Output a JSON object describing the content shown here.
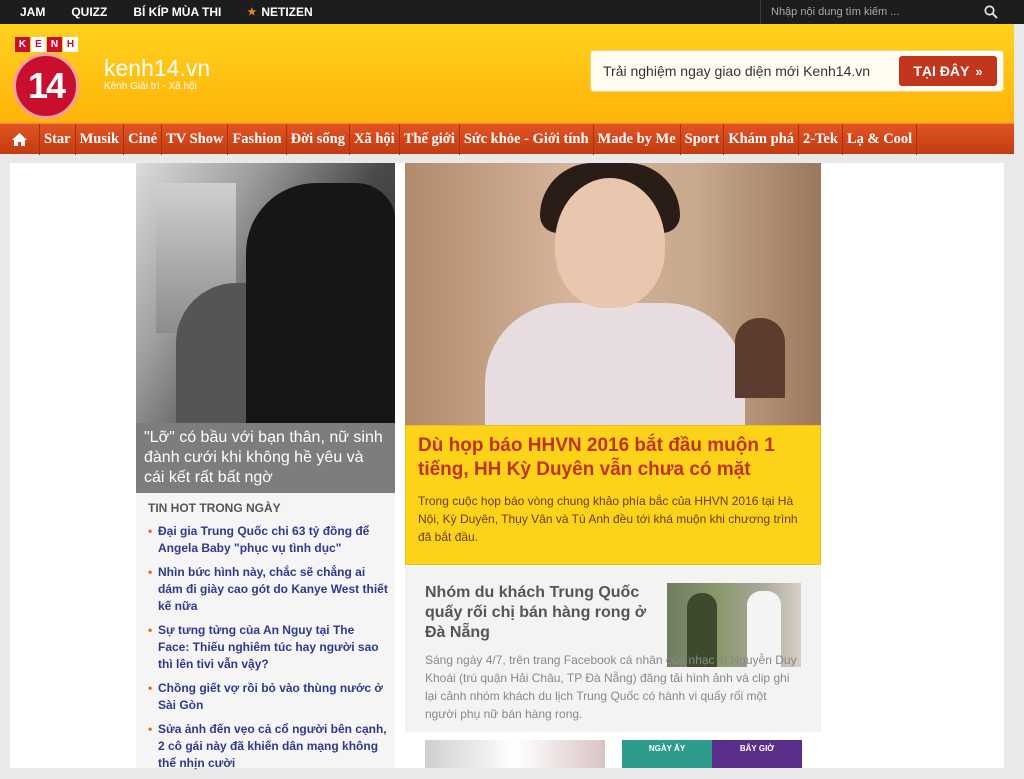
{
  "topbar": {
    "links": [
      {
        "label": "JAM",
        "star": false
      },
      {
        "label": "QUIZZ",
        "star": false
      },
      {
        "label": "BÍ KÍP MÙA THI",
        "star": false
      },
      {
        "label": "NETIZEN",
        "star": true
      }
    ],
    "search_placeholder": "Nhập nội dung tìm kiếm ..."
  },
  "header": {
    "logo_letters": [
      "K",
      "E",
      "N",
      "H"
    ],
    "logo_number": "14",
    "site_name": "kenh14.vn",
    "tagline": "Kênh Giải trí - Xã hội",
    "promo_text": "Trải nghiệm ngay giao diện mới Kenh14.vn",
    "promo_button": "TẠI ĐÂY",
    "brand_red": "#c8102e",
    "header_yellow": "#ffc413"
  },
  "nav": {
    "items": [
      "Star",
      "Musik",
      "Ciné",
      "TV Show",
      "Fashion",
      "Đời sống",
      "Xã hội",
      "Thế giới",
      "Sức khỏe - Giới tính",
      "Made by Me",
      "Sport",
      "Khám phá",
      "2-Tek",
      "Lạ & Cool"
    ],
    "color": "#d8481a"
  },
  "left_feature": {
    "caption": "\"Lỡ\" có bầu với bạn thân, nữ sinh đành cưới khi không hề yêu và cái kết rất bất ngờ"
  },
  "hot": {
    "title": "TIN HOT TRONG NGÀY",
    "items": [
      "Đại gia Trung Quốc chi 63 tỷ đồng để Angela Baby \"phục vụ tình dục\"",
      "Nhìn bức hình này, chắc sẽ chẳng ai dám đi giày cao gót do Kanye West thiết kế nữa",
      "Sự tưng tửng của An Nguy tại The Face: Thiếu nghiêm túc hay người sao thì lên tivi vẫn vậy?",
      "Chồng giết vợ rồi bỏ vào thùng nước ở Sài Gòn",
      "Sửa ảnh đến vẹo cả cổ người bên cạnh, 2 cô gái này đã khiến dân mạng không thể nhịn cười"
    ]
  },
  "main_feature": {
    "title": "Dù họp báo HHVN 2016 bắt đầu muộn 1 tiếng, HH Kỳ Duyên vẫn chưa có mặt",
    "summary": "Trong cuộc họp báo vòng chung khảo phía bắc của HHVN 2016 tại Hà Nội, Kỳ Duyên, Thụy Vân và Tú Anh đều tới khá muộn khi chương trình đã bắt đầu.",
    "title_color": "#c0331c",
    "bg_color": "#fdd319"
  },
  "story2": {
    "title": "Nhóm du khách Trung Quốc quấy rối chị bán hàng rong ở Đà Nẵng",
    "summary": "Sáng ngày 4/7, trên trang Facebook cá nhân của nhạc sĩ Nguyễn Duy Khoái (trú quận Hải Châu, TP Đà Nẵng) đăng tải hình ảnh và clip ghi lại cảnh nhóm khách du lịch Trung Quốc có hành vi quấy rối một người phụ nữ bán hàng rong."
  },
  "promo_boxes": [
    "NGÀY ẤY",
    "BÂY GIỜ"
  ]
}
